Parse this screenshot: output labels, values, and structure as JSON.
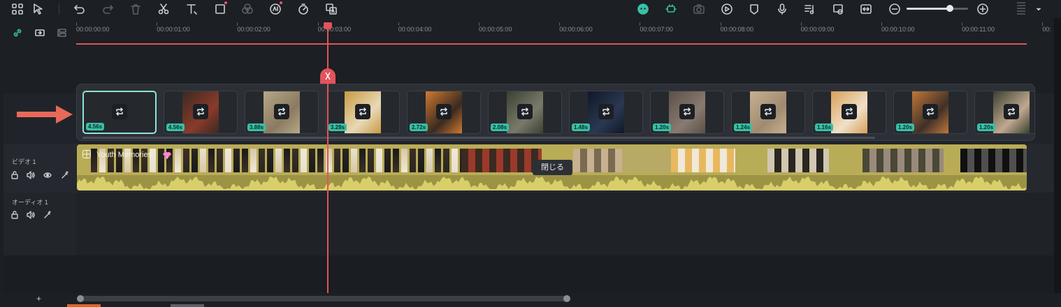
{
  "toolbar": {
    "left_icons": [
      "layout-icon",
      "select-tool-icon",
      "undo-icon",
      "redo-icon",
      "delete-icon",
      "cut-icon",
      "text-icon",
      "crop-icon",
      "color-match-icon",
      "ai-voice-icon",
      "speed-icon",
      "ai-translate-icon"
    ],
    "right_icons": [
      "ai-copilot-icon",
      "auto-highlight-icon",
      "snapshot-icon",
      "render-preview-icon",
      "marker-icon",
      "microphone-icon",
      "audio-mix-icon",
      "replace-icon",
      "fit-timeline-icon",
      "zoom-out-icon",
      "zoom-in-icon"
    ],
    "zoom_level": 0.7,
    "accent_color": "#e2535c"
  },
  "ruler": {
    "ticks": [
      "00:00:00:00",
      "00:00:01:00",
      "00:00:02:00",
      "00:00:03:00",
      "00:00:04:00",
      "00:00:05:00",
      "00:00:06:00",
      "00:00:07:00",
      "00:00:08:00",
      "00:00:09:00",
      "00:00:10:00",
      "00:00:11:00",
      "00:"
    ]
  },
  "clip_strip": {
    "clips": [
      {
        "duration": "4.56s",
        "selected": true
      },
      {
        "duration": "4.56s"
      },
      {
        "duration": "3.88s"
      },
      {
        "duration": "3.28s"
      },
      {
        "duration": "2.72s"
      },
      {
        "duration": "2.08s"
      },
      {
        "duration": "1.48s"
      },
      {
        "duration": "1.20s"
      },
      {
        "duration": "1.24s"
      },
      {
        "duration": "1.16s"
      },
      {
        "duration": "1.20s"
      },
      {
        "duration": "1.20s"
      }
    ],
    "badge_color": "#38c0a7"
  },
  "tracks": {
    "video": {
      "name": "ビデオ 1",
      "clip_title": "Youth Memories",
      "clip_color": "#b9ac57"
    },
    "audio": {
      "name": "オーディオ 1"
    }
  },
  "tooltip": {
    "text": "閉じる"
  },
  "bottom": {
    "add_track": "+"
  }
}
